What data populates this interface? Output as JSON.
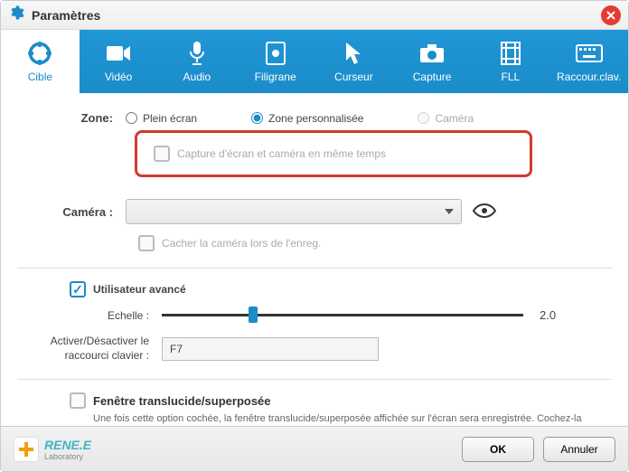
{
  "window": {
    "title": "Paramètres"
  },
  "tabs": [
    {
      "label": "Cible"
    },
    {
      "label": "Vidéo"
    },
    {
      "label": "Audio"
    },
    {
      "label": "Filigrane"
    },
    {
      "label": "Curseur"
    },
    {
      "label": "Capture"
    },
    {
      "label": "FLL"
    },
    {
      "label": "Raccour.clav."
    }
  ],
  "zone": {
    "label": "Zone:",
    "full": "Plein écran",
    "custom": "Zone personnalisée",
    "camera": "Caméra",
    "capture_both": "Capture d'écran et caméra en même temps"
  },
  "camera": {
    "label": "Caméra :",
    "hide_label": "Cacher la caméra lors de l'enreg."
  },
  "advanced": {
    "label": "Utilisateur avancé",
    "scale_label": "Echelle :",
    "scale_value": "2.0",
    "hotkey_label": "Activer/Désactiver le raccourci clavier :",
    "hotkey_value": "F7"
  },
  "translucent": {
    "title": "Fenêtre translucide/superposée",
    "desc": "Une fois cette option cochée, la fenêtre translucide/superposée affichée sur l'écran sera enregistrée. Cochez-la uniquement au moment nécessaire car cette option ralentira la vitesse de l'enregistrement."
  },
  "brand": {
    "name": "RENE.E",
    "sub": "Laboratory"
  },
  "buttons": {
    "ok": "OK",
    "cancel": "Annuler"
  }
}
